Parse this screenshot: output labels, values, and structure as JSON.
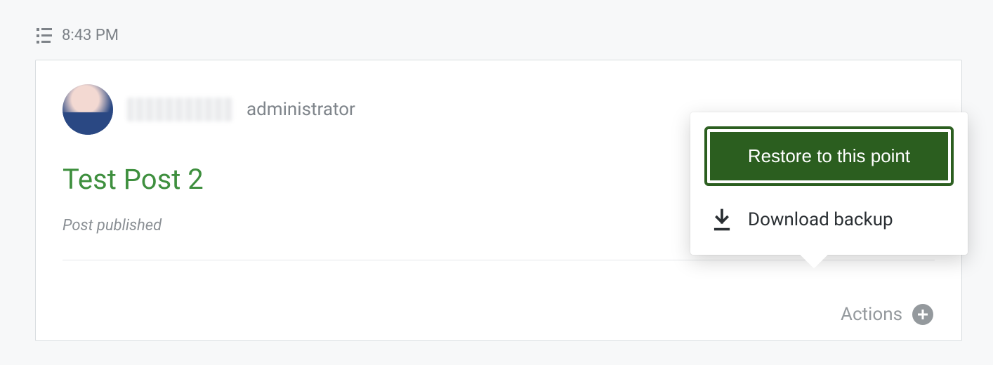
{
  "timestamp": "8:43 PM",
  "entry": {
    "user_role": "administrator",
    "post_title": "Test Post 2",
    "post_status": "Post published"
  },
  "actions": {
    "label": "Actions"
  },
  "popover": {
    "restore_label": "Restore to this point",
    "download_label": "Download backup"
  }
}
